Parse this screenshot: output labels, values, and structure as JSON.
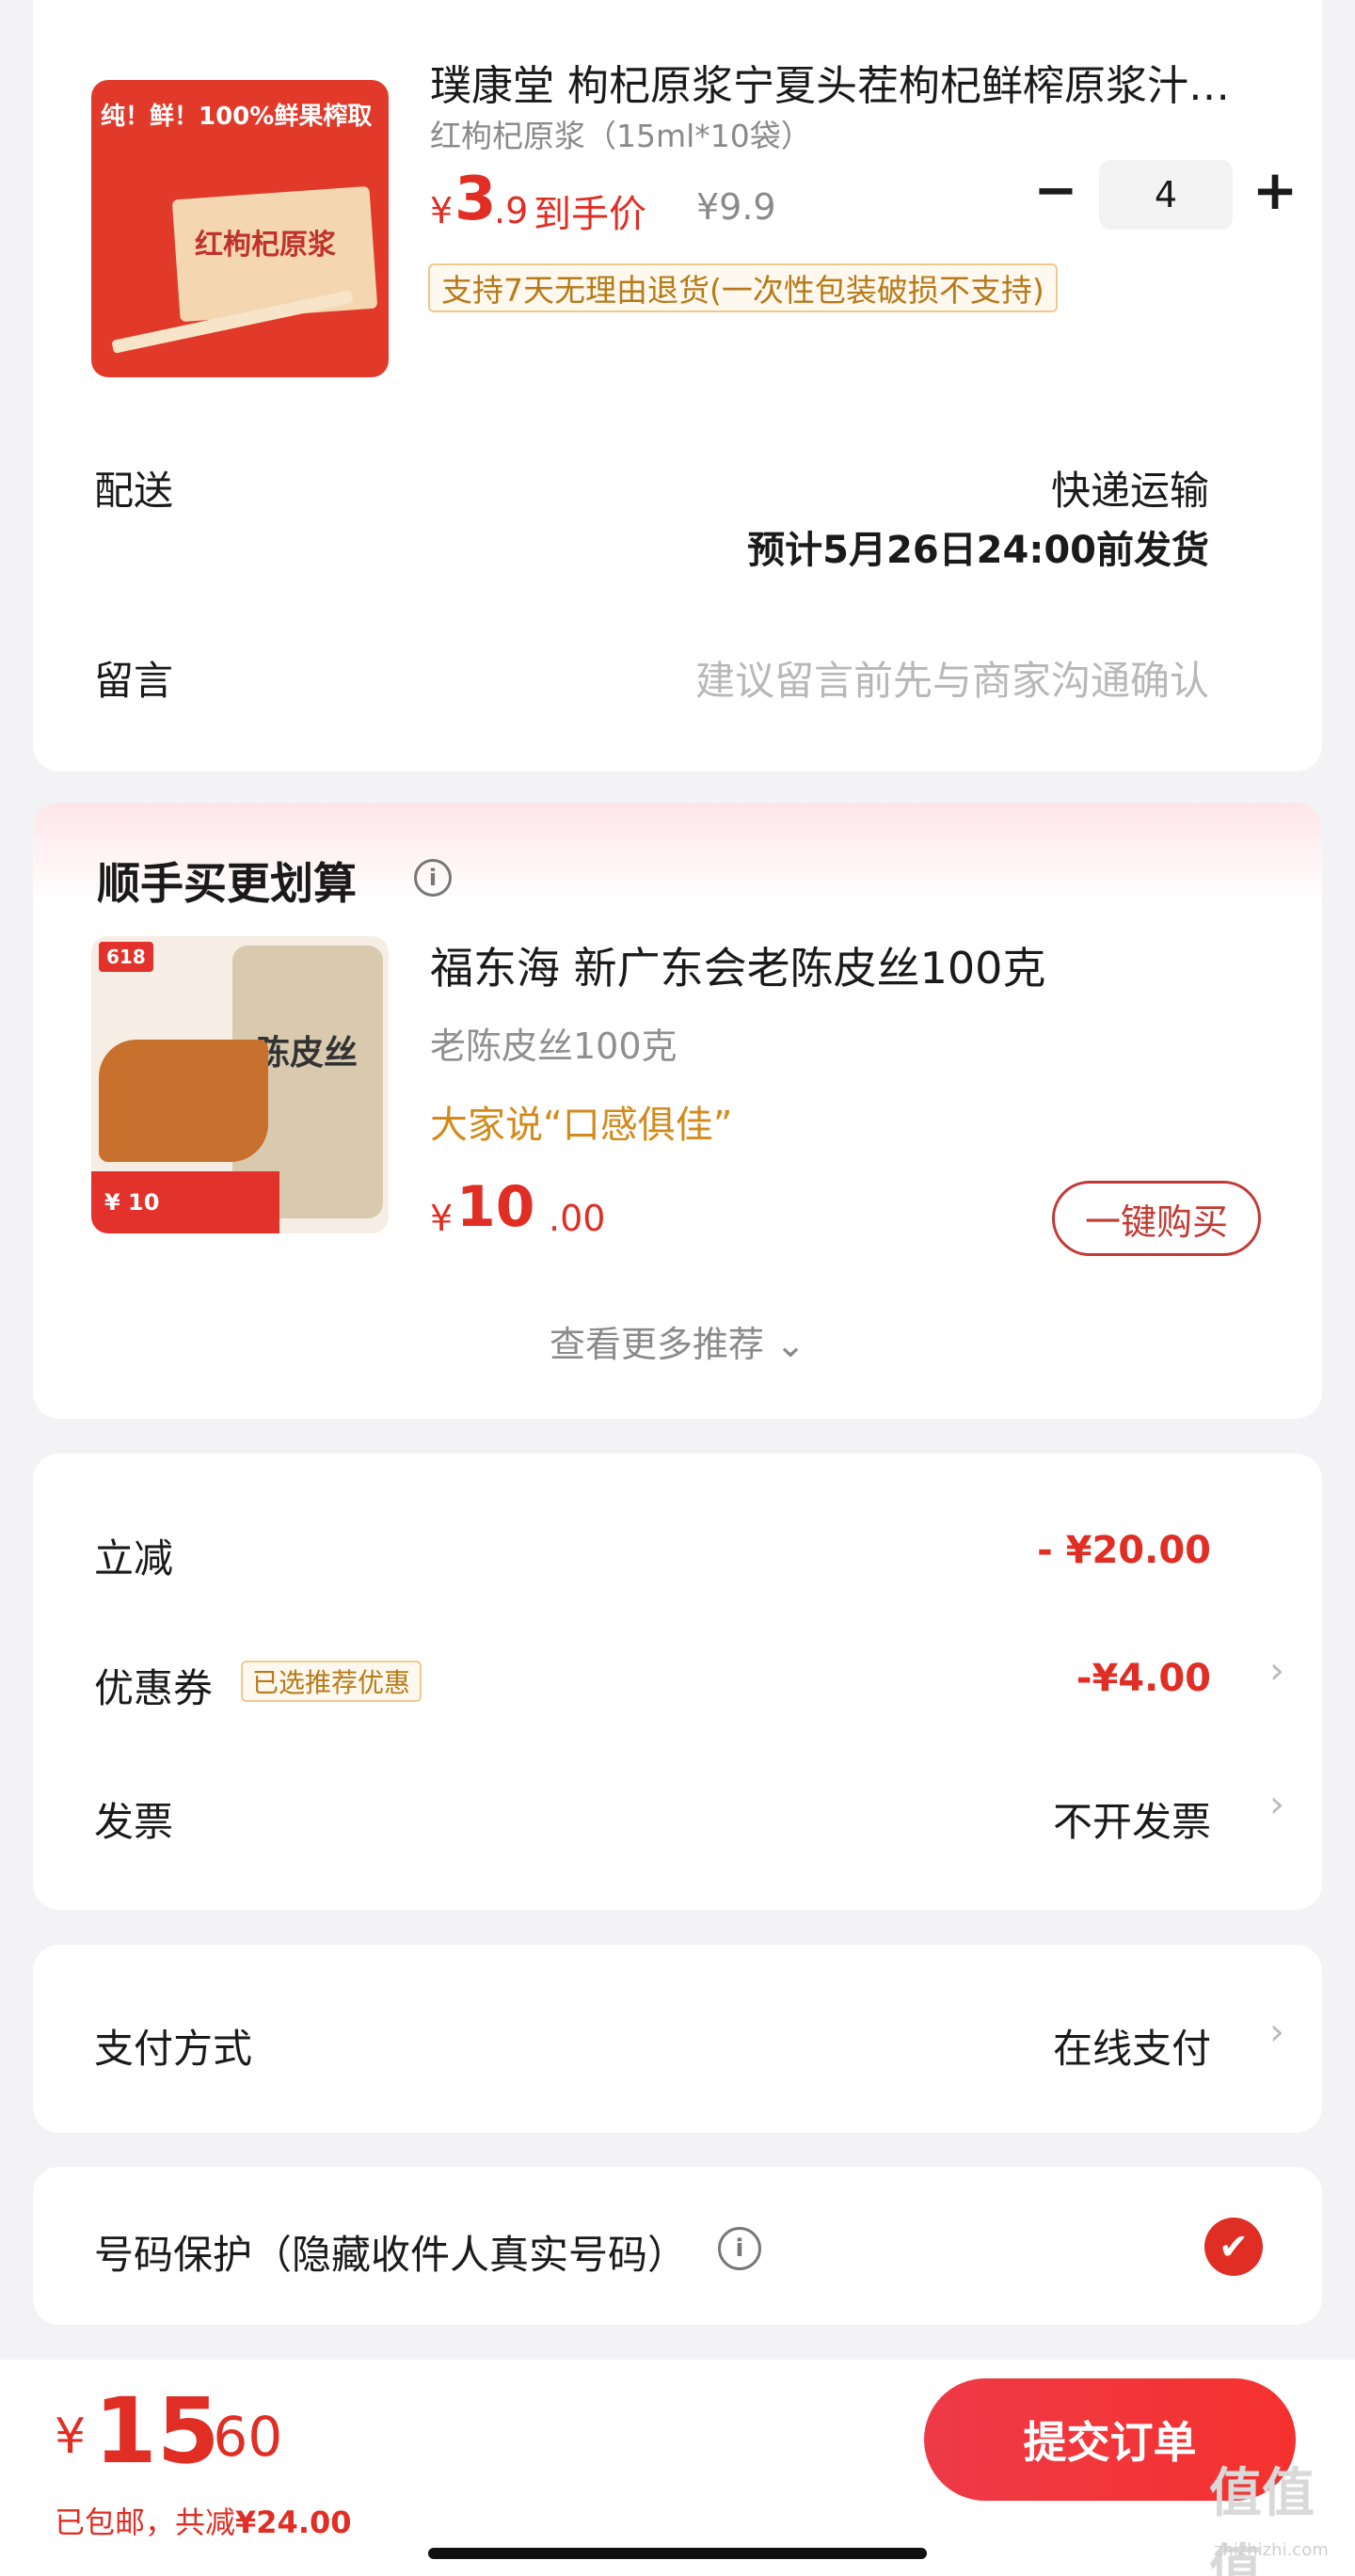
{
  "product": {
    "title": "璞康堂 枸杞原浆宁夏头茬枸杞鲜榨原浆汁…",
    "sku": "红枸杞原浆（15ml*10袋）",
    "price_yen": "¥",
    "price_int": "3",
    "price_dec": ".9",
    "price_label": "到手价",
    "orig_price": "¥9.9",
    "quantity": "4",
    "minus": "−",
    "plus": "+",
    "return_tag": "支持7天无理由退货(一次性包装破损不支持)",
    "thumb_text_1": "纯！鲜！100%鲜果榨取",
    "thumb_text_2": "红枸杞原浆"
  },
  "shipping": {
    "label": "配送",
    "method": "快递运输",
    "eta": "预计5月26日24:00前发货"
  },
  "message": {
    "label": "留言",
    "placeholder": "建议留言前先与商家沟通确认"
  },
  "recommend": {
    "title": "顺手买更划算",
    "info_icon": "i",
    "name": "福东海 新广东会老陈皮丝100克",
    "spec": "老陈皮丝100克",
    "praise": "大家说“口感俱佳”",
    "price_yen": "¥",
    "price_int": "10",
    "price_dec": ".00",
    "buy_label": "一键购买",
    "more_label": "查看更多推荐 ⌄",
    "thumb_text": "陈皮丝",
    "thumb_badge": "618",
    "thumb_price": "¥ 10"
  },
  "discount": {
    "label": "立减",
    "value": "- ¥20.00"
  },
  "coupon": {
    "label": "优惠券",
    "tag": "已选推荐优惠",
    "value": "-¥4.00"
  },
  "invoice": {
    "label": "发票",
    "value": "不开发票"
  },
  "payment": {
    "label": "支付方式",
    "value": "在线支付"
  },
  "phone_protect": {
    "label": "号码保护（隐藏收件人真实号码）",
    "info_icon": "i",
    "checked_glyph": "✔"
  },
  "bottom": {
    "total_yen": "¥",
    "total_int": "15",
    "total_dec": ".60",
    "sub_prefix": "已包邮，共减",
    "sub_value": "¥24.00",
    "submit_label": "提交订单"
  },
  "watermark": {
    "main": "值值值",
    "sub": "zhizhizhi.com"
  },
  "chevron": "›",
  "colors": {
    "accent": "#e02e24",
    "tag_border": "#f0c98d",
    "tag_text": "#b67a18",
    "praise": "#d48a1a"
  }
}
